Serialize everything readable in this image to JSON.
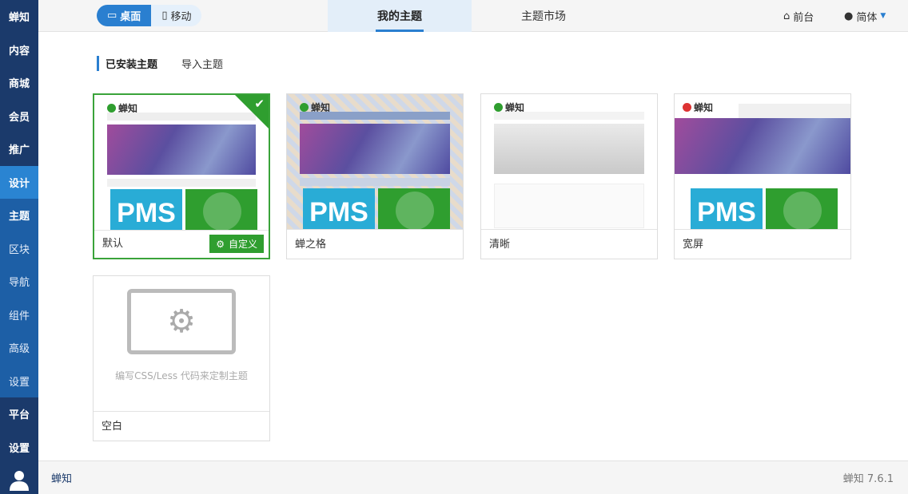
{
  "sidebar": {
    "brand": "蝉知",
    "items": [
      "内容",
      "商城",
      "会员",
      "推广",
      "设计"
    ],
    "sub": [
      "主题",
      "区块",
      "导航",
      "组件",
      "高级",
      "设置"
    ],
    "bottom": [
      "平台",
      "设置"
    ]
  },
  "topbar": {
    "desktop": "桌面",
    "mobile": "移动",
    "tabs": [
      "我的主题",
      "主题市场"
    ],
    "frontend": "前台",
    "lang": "简体"
  },
  "subtabs": [
    "已安装主题",
    "导入主题"
  ],
  "themes": [
    {
      "name": "默认",
      "action": "自定义",
      "selected": true
    },
    {
      "name": "蝉之格"
    },
    {
      "name": "清晰"
    },
    {
      "name": "宽屏"
    },
    {
      "name": "空白",
      "hint": "编写CSS/Less 代码来定制主题"
    }
  ],
  "footer": {
    "left": "蝉知",
    "version": "蝉知 7.6.1"
  }
}
